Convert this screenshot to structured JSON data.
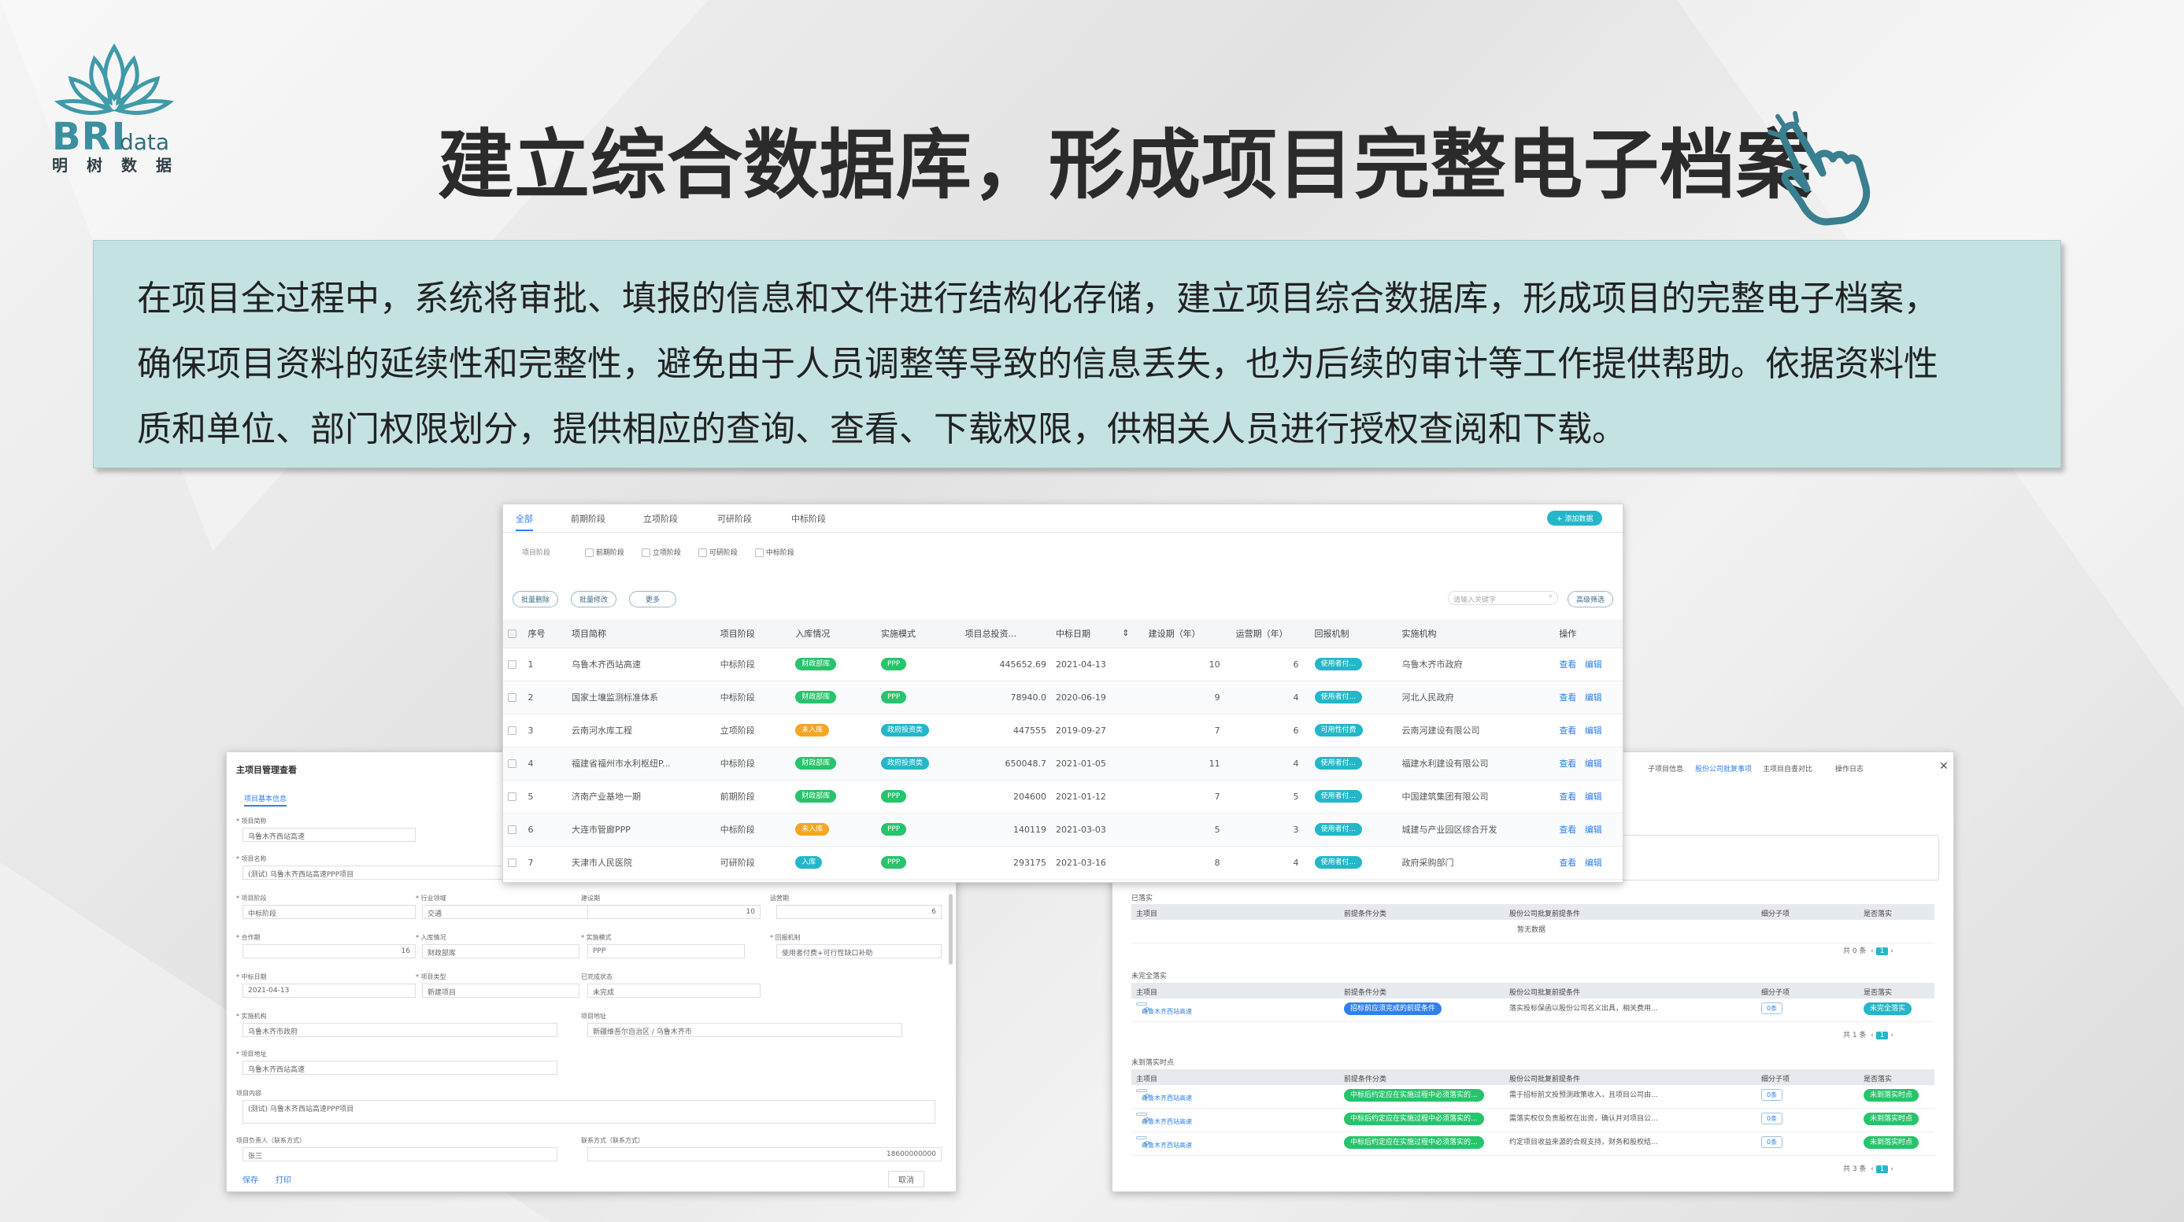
{
  "logo": {
    "brand": "BRI",
    "brand_suffix": "data",
    "cn": "明树数据"
  },
  "title": "建立综合数据库，形成项目完整电子档案",
  "description": [
    "在项目全过程中，系统将审批、填报的信息和文件进行结构化存储，建立项目综合数据库，形成项目的完整电子档案，",
    "确保项目资料的延续性和完整性，避免由于人员调整等导致的信息丢失，也为后续的审计等工作提供帮助。依据资料性",
    "质和单位、部门权限划分，提供相应的查询、查看、下载权限，供相关人员进行授权查阅和下载。"
  ],
  "list_panel": {
    "tabs": [
      "全部",
      "前期阶段",
      "立项阶段",
      "可研阶段",
      "中标阶段"
    ],
    "add_button": "+ 添加数据",
    "filter_label": "项目阶段",
    "filters": [
      "前期阶段",
      "立项阶段",
      "可研阶段",
      "中标阶段"
    ],
    "actions": [
      "批量删除",
      "批量修改",
      "更多"
    ],
    "search_placeholder": "请输入关键字",
    "advanced": "高级筛选",
    "columns": [
      "",
      "序号",
      "项目简称",
      "项目阶段",
      "入库情况",
      "实施模式",
      "项目总投资...",
      "中标日期",
      "",
      "建设期（年）",
      "运营期（年）",
      "回报机制",
      "实施机构",
      "操作"
    ],
    "rows": [
      {
        "no": "1",
        "name": "乌鲁木齐西站高速",
        "stage": "中标阶段",
        "status": "财政部库",
        "mode": "PPP",
        "invest": "445652.69",
        "date": "2021-04-13",
        "build": "10",
        "op": "6",
        "ret": "使用者付...",
        "org": "乌鲁木齐市政府",
        "view": "查看",
        "edit": "编辑"
      },
      {
        "no": "2",
        "name": "国家土壤监测标准体系",
        "stage": "中标阶段",
        "status": "财政部库",
        "mode": "PPP",
        "invest": "78940.0",
        "date": "2020-06-19",
        "build": "9",
        "op": "4",
        "ret": "使用者付...",
        "org": "河北人民政府",
        "view": "查看",
        "edit": "编辑"
      },
      {
        "no": "3",
        "name": "云南河水库工程",
        "stage": "立项阶段",
        "status": "未入库",
        "mode": "政府投资类",
        "invest": "447555",
        "date": "2019-09-27",
        "build": "7",
        "op": "6",
        "ret": "可用性付费",
        "org": "云南河建设有限公司",
        "view": "查看",
        "edit": "编辑"
      },
      {
        "no": "4",
        "name": "福建省福州市水利枢纽P...",
        "stage": "中标阶段",
        "status": "财政部库",
        "mode": "政府投资类",
        "invest": "650048.7",
        "date": "2021-01-05",
        "build": "11",
        "op": "4",
        "ret": "使用者付...",
        "org": "福建水利建设有限公司",
        "view": "查看",
        "edit": "编辑"
      },
      {
        "no": "5",
        "name": "济南产业基地一期",
        "stage": "前期阶段",
        "status": "财政部库",
        "mode": "PPP",
        "invest": "204600",
        "date": "2021-01-12",
        "build": "7",
        "op": "5",
        "ret": "使用者付...",
        "org": "中国建筑集团有限公司",
        "view": "查看",
        "edit": "编辑"
      },
      {
        "no": "6",
        "name": "大连市管廊PPP",
        "stage": "中标阶段",
        "status": "未入库",
        "mode": "PPP",
        "invest": "140119",
        "date": "2021-03-03",
        "build": "5",
        "op": "3",
        "ret": "使用者付...",
        "org": "城建与产业园区综合开发",
        "view": "查看",
        "edit": "编辑"
      },
      {
        "no": "7",
        "name": "天津市人民医院",
        "stage": "可研阶段",
        "status": "入库",
        "mode": "PPP",
        "invest": "293175",
        "date": "2021-03-16",
        "build": "8",
        "op": "4",
        "ret": "使用者付...",
        "org": "政府采购部门",
        "view": "查看",
        "edit": "编辑"
      }
    ]
  },
  "detail_panel": {
    "title": "主项目管理查看",
    "section": "项目基本信息",
    "fields": [
      {
        "label": "* 项目简称",
        "value": "乌鲁木齐西站高速"
      },
      {
        "label": "* 项目名称",
        "value": "(测试) 乌鲁木齐西站高速PPP项目"
      },
      {
        "label": "* 项目阶段",
        "value": "中标阶段"
      },
      {
        "label": "* 行业领域",
        "value": "交通"
      },
      {
        "label": "建设期",
        "value": "10"
      },
      {
        "label": "运营期",
        "value": "6"
      },
      {
        "label": "* 合作期",
        "value": "16"
      },
      {
        "label": "* 入库情况",
        "value": "财政部库"
      },
      {
        "label": "* 实施模式",
        "value": "PPP"
      },
      {
        "label": "* 回报机制",
        "value": "使用者付费+可行性缺口补助"
      },
      {
        "label": "* 中标日期",
        "value": "2021-04-13"
      },
      {
        "label": "* 项目类型",
        "value": "新建项目"
      },
      {
        "label": "已完成状态",
        "value": "未完成"
      },
      {
        "label": "* 实施机构",
        "value": "乌鲁木齐市政府"
      },
      {
        "label": "项目地址",
        "value": "新疆维吾尔自治区 / 乌鲁木齐市"
      },
      {
        "label": "* 项目地址",
        "value": "乌鲁木齐西站高速"
      },
      {
        "label": "项目内容",
        "value": "(测试) 乌鲁木齐西站高速PPP项目"
      },
      {
        "label": "项目负责人（联系方式）",
        "value": "张三"
      },
      {
        "label": "联系方式（联系方式）",
        "value": "18600000000"
      }
    ],
    "footer_left": [
      "保存",
      "打印"
    ],
    "footer_right": "取消"
  },
  "right_panel": {
    "tabs": [
      "子项目信息",
      "股份公司批复事项",
      "主项目自查对比",
      "操作日志"
    ],
    "section1": "已落实",
    "section2": "未完全落实",
    "section3": "未到落实时点",
    "headers": [
      "主项目",
      "前提条件分类",
      "股份公司批复前提条件",
      "细分子项",
      "是否落实"
    ],
    "empty": "暂无数据",
    "rows2": [
      {
        "project": "乌鲁木齐西站高速",
        "cat": "招标前应须完成的前提条件",
        "cond": "落实投标保函以股份公司名义出具，相关费用...",
        "sub": "0条",
        "state": "未完全落实"
      }
    ],
    "rows3": [
      {
        "project": "乌鲁木齐西站高速",
        "cat": "中标后约定应在实施过程中必须落实的...",
        "cond": "需于招标前文投预测政策收入，且项目公司由...",
        "sub": "0条",
        "state": "未到落实时点"
      },
      {
        "project": "乌鲁木齐西站高速",
        "cat": "中标后约定应在实施过程中必须落实的...",
        "cond": "需落实权仅负责股权在出资，确认并对项目公...",
        "sub": "0条",
        "state": "未到落实时点"
      },
      {
        "project": "乌鲁木齐西站高速",
        "cat": "中标后约定应在实施过程中必须落实的...",
        "cond": "约定项目收益来源的合规支持，财务和股权结...",
        "sub": "0条",
        "state": "未到落实时点"
      }
    ],
    "pager1": "共 0 条",
    "pager2": "共 1 条",
    "pager3": "共 3 条",
    "page_no": "1"
  },
  "colors": {
    "accent": "#23b7c9",
    "green": "#27c46b",
    "orange": "#f5a623",
    "blue": "#2f80ed",
    "desc_bg": "#c5e2e3"
  }
}
